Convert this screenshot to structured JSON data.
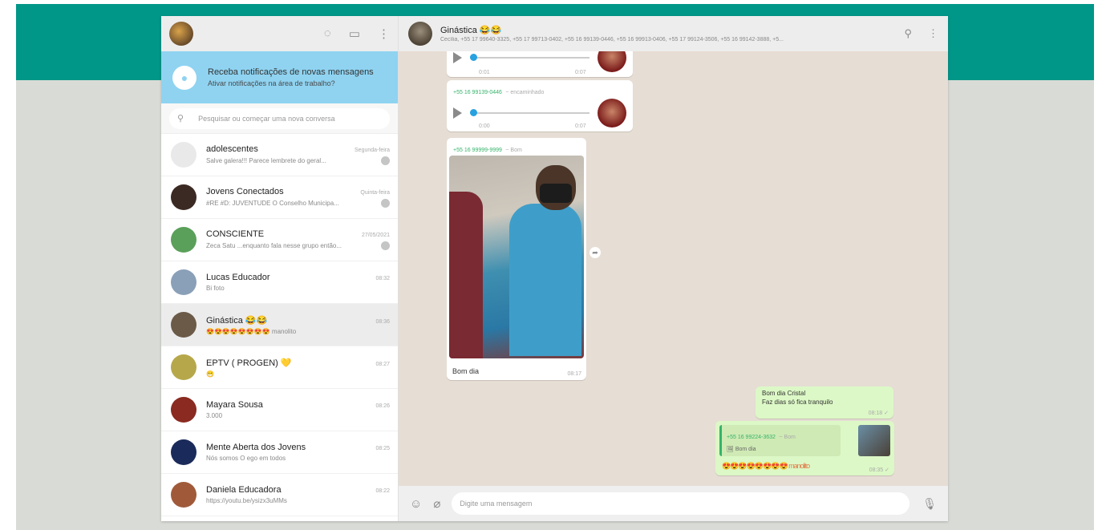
{
  "colors": {
    "brand_green": "#009688",
    "notif_blue": "#8fd3f1",
    "chat_bg": "#e6ddd4",
    "outgoing": "#dcf8c6"
  },
  "left_header": {
    "icons": [
      "status-icon",
      "new-chat-icon",
      "menu-icon"
    ]
  },
  "notification": {
    "title": "Receba notificações de novas mensagens",
    "subtitle": "Ativar notificações na área de trabalho?"
  },
  "search": {
    "placeholder": "Pesquisar ou começar uma nova conversa"
  },
  "chats": [
    {
      "name": "adolescentes",
      "time": "Segunda-feira",
      "msg": "Salve galera!!! Parece lembrete do geral...",
      "muted": true,
      "avatar_color": "#e9e9e9"
    },
    {
      "name": "Jovens Conectados",
      "time": "Quinta-feira",
      "msg": "#RE #D: JUVENTUDE O Conselho Municipa...",
      "muted": true,
      "avatar_color": "#3b2a23"
    },
    {
      "name": "CONSCIENTE",
      "time": "27/05/2021",
      "msg": "Zeca Satu ...enquanto fala nesse grupo então...",
      "muted": true,
      "avatar_color": "#5aa05a"
    },
    {
      "name": "Lucas Educador",
      "time": "08:32",
      "msg": "Bi foto",
      "muted": false,
      "avatar_color": "#8aa0b8"
    },
    {
      "name": "Ginástica 😂😂",
      "time": "08:36",
      "msg": "😍😍😍😍😍😍😍😍 manolito",
      "muted": false,
      "avatar_color": "#6b5a48"
    },
    {
      "name": "EPTV ( PROGEN) 💛",
      "time": "08:27",
      "msg": "😁",
      "muted": false,
      "avatar_color": "#b6a84a"
    },
    {
      "name": "Mayara Sousa",
      "time": "08:26",
      "msg": "3.000",
      "muted": false,
      "avatar_color": "#8a2a20"
    },
    {
      "name": "Mente Aberta dos Jovens",
      "time": "08:25",
      "msg": "Nós somos O ego em todos",
      "muted": false,
      "avatar_color": "#1a2a5a"
    },
    {
      "name": "Daniela Educadora",
      "time": "08:22",
      "msg": "https://youtu.be/ysizx3uMMs",
      "muted": false,
      "avatar_color": "#a05a3a"
    }
  ],
  "conversation": {
    "title": "Ginástica 😂😂",
    "subtitle": "Cecília, +55 17 99640-3325, +55 17 99713-0402, +55 16 99139-0446, +55 16 99913-0406, +55 17 99124-3506, +55 16 99142-3888, +5...",
    "header_icons": [
      "search-icon",
      "menu-icon"
    ]
  },
  "messages": {
    "audio1": {
      "elapsed": "0:01",
      "duration": "0:07"
    },
    "audio2": {
      "sender": "+55 16 99139-0446",
      "status": "~ encaminhado",
      "elapsed": "0:00",
      "duration": "0:07"
    },
    "photo": {
      "sender": "+55 16 99999-9999",
      "status": "~ Bom",
      "caption": "Bom dia",
      "time": "08:17"
    },
    "out1": {
      "line1": "Bom dia Cristal",
      "line2": "Faz dias só fica tranquilo",
      "time": "08:18 ✓"
    },
    "out2": {
      "quote_sender": "+55 16 99224-3632",
      "quote_tag": "~ Bom",
      "quote_text": "🖼 Bom dia",
      "text": "😍😍😍😍😍😍😍😍 manolito",
      "time": "08:35 ✓"
    }
  },
  "compose": {
    "placeholder": "Digite uma mensagem"
  }
}
